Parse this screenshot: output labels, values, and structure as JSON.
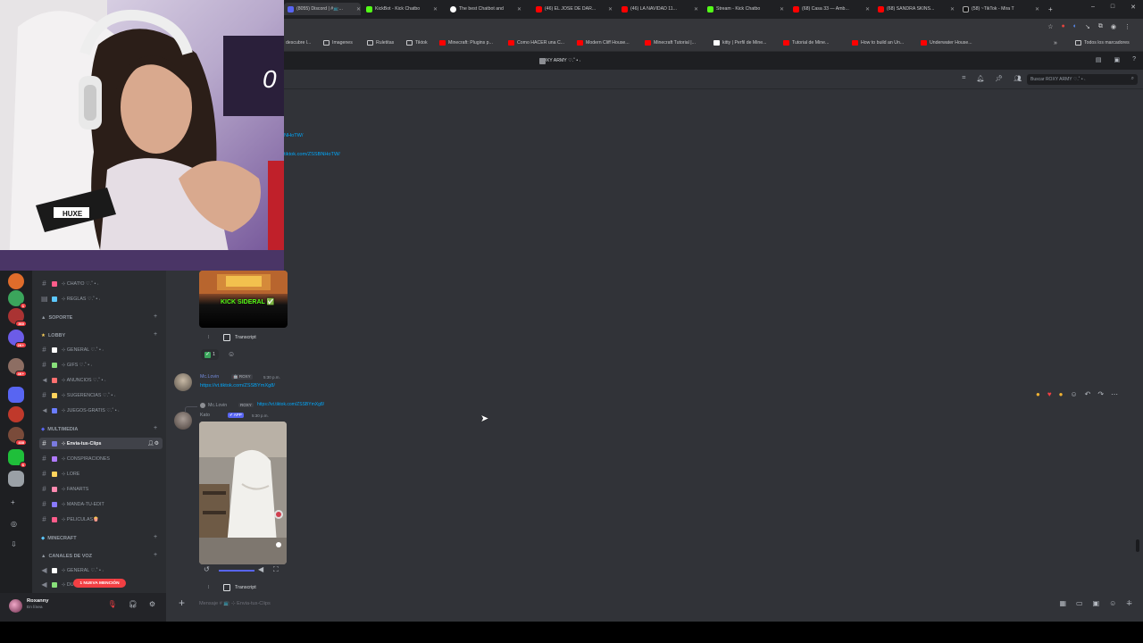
{
  "browser": {
    "tabs": [
      {
        "title": "(8055) Discord | #📺...",
        "color": "#5865f2"
      },
      {
        "title": "KickBot - Kick Chatbo",
        "color": "#53fc18"
      },
      {
        "title": "The best Chatbot and",
        "color": "#ffffff"
      },
      {
        "title": "(46) EL JOSE DE DAR...",
        "color": "#ff0000"
      },
      {
        "title": "(46) LA NAVIDAD 11...",
        "color": "#ff0000"
      },
      {
        "title": "Stream - Kick Chatbo",
        "color": "#53fc18"
      },
      {
        "title": "(68) Casa 33 — Amb...",
        "color": "#ff0000"
      },
      {
        "title": "(68) SANDRA SKINS...",
        "color": "#ff0000"
      },
      {
        "title": "(58) ~TikTok - Mira T",
        "color": "#111111"
      }
    ],
    "bookmarks": [
      {
        "label": "descubre l...",
        "color": "#8ab4f8"
      },
      {
        "label": "Imagenes",
        "color": "#c8c9cc"
      },
      {
        "label": "Ruletitas",
        "color": "#c8c9cc"
      },
      {
        "label": "Tiktok",
        "color": "#c8c9cc"
      },
      {
        "label": "Minecraft: Plugins p...",
        "color": "#ff0000"
      },
      {
        "label": "Como HACER una C...",
        "color": "#ff0000"
      },
      {
        "label": "Modern Cliff House...",
        "color": "#ff0000"
      },
      {
        "label": "Minecraft Tutorial |...",
        "color": "#ff0000"
      },
      {
        "label": "kitty | Perfil de Mine...",
        "color": "#ffffff"
      },
      {
        "label": "Tutorial de Mine...",
        "color": "#ff0000"
      },
      {
        "label": "How to build an Un...",
        "color": "#ff0000"
      },
      {
        "label": "Underwater House...",
        "color": "#ff0000"
      }
    ],
    "all_bookmarks": "Todos los marcadores",
    "window_controls": [
      "–",
      "□",
      "✕"
    ]
  },
  "discord": {
    "server_title": "ROXY ARMY ♡.˚ • ˖",
    "search_placeholder": "Buscar ROXY ARMY ♡.˚ • ˖",
    "top_links": [
      "NHoTW/",
      "tiktok.com/ZSSBNHoTW/"
    ],
    "categories": {
      "support": "SOPORTE",
      "lobby": "LOBBY",
      "multimedia": "MULTIMEDIA",
      "minecraft": "MINECRAFT",
      "voice": "CANALES DE VOZ"
    },
    "channels": [
      {
        "label": "⊹ CHAT!O ♡.˚ • ˖",
        "emo": "#ff5c8a"
      },
      {
        "label": "⊹ REGLAS ♡.˚ • ˖",
        "emo": "#5cc8ff"
      },
      {
        "label": "⊹ GENERAL ♡.˚ • ˖",
        "emo": "#ffffff"
      },
      {
        "label": "⊹ GIFS ♡.˚ • ˖",
        "emo": "#88e07a"
      },
      {
        "label": "⊹ ANUNCIOS ♡.˚ • ˖",
        "emo": "#ff7070"
      },
      {
        "label": "⊹ SUGERENCIAS ♡.˚ • ˖",
        "emo": "#ffd35c"
      },
      {
        "label": "⊹ JUEGOS-GRATIS ♡.˚ • ˖",
        "emo": "#6a7cff"
      },
      {
        "label": "⊹ Envia-tus-Clips",
        "emo": "#7a7ae0"
      },
      {
        "label": "⊹ CONSPIRACIONES",
        "emo": "#b07aff"
      },
      {
        "label": "⊹ LORE",
        "emo": "#ffd35c"
      },
      {
        "label": "⊹ FANARTS",
        "emo": "#ff8ab0"
      },
      {
        "label": "⊹ MANDA-TU-EDIT",
        "emo": "#8a7aff"
      },
      {
        "label": "⊹ PELICULAS🍿",
        "emo": "#ff5c8a"
      },
      {
        "label": "⊹ GENERAL ♡.˚ • ˖",
        "emo": "#ffffff"
      },
      {
        "label": "⊹ DUO",
        "emo": "#88e07a"
      }
    ],
    "new_mention": "1 NUEVA MENCIÓN",
    "user": {
      "name": "Roxanny",
      "status": "En línea"
    },
    "messages": {
      "clip_banner": "KICK SIDERAL ✅",
      "transcript": "Transcript",
      "reaction_count": "1",
      "msg1": {
        "user": "Mc.Lovin",
        "tag": "🤖 ROXY",
        "time": "5:30 p.m.",
        "link": "https://vt.tiktok.com/ZSSBYmXg8/"
      },
      "msg2_reply": {
        "user": "Mc.Lovin",
        "tag": "ROXY",
        "link": "https://vt.tiktok.com/ZSSBYmXg8/"
      },
      "msg2": {
        "user": "Kato",
        "tag": "✔ APP",
        "time": "5:30 p.m."
      }
    },
    "composer_placeholder": "Mensaje # 📺 ⊹ Envia-tus-Clips",
    "rail_badges": [
      "1",
      "360",
      "2K+",
      "4K+",
      "438",
      "6"
    ]
  }
}
